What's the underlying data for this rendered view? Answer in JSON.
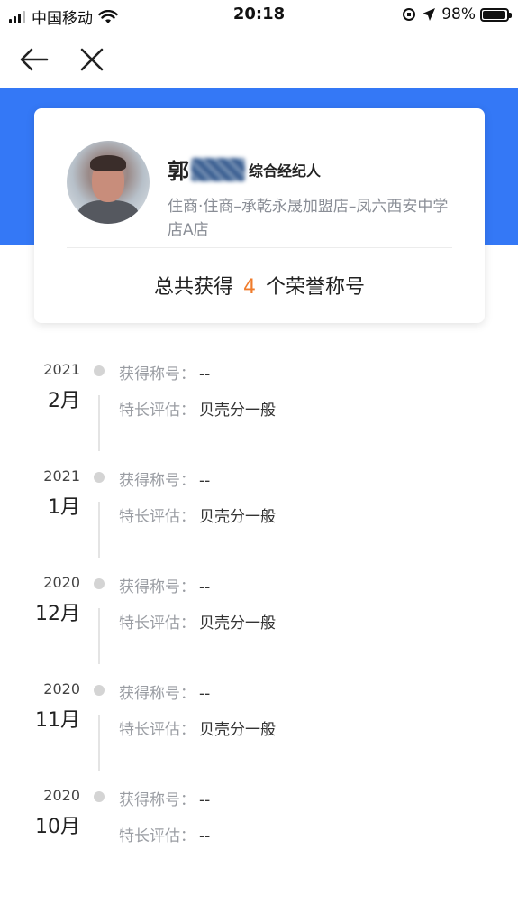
{
  "status_bar": {
    "carrier": "中国移动",
    "time": "20:18",
    "battery_percent": "98%",
    "battery_level": 0.98
  },
  "nav": {
    "back_icon": "arrow-left-icon",
    "close_icon": "close-icon"
  },
  "card": {
    "name": "郭",
    "role": "综合经纪人",
    "store": "住商·住商–承乾永晟加盟店–凤六西安中学店A店",
    "honor_prefix": "总共获得",
    "honor_count": "4",
    "honor_suffix": "个荣誉称号"
  },
  "timeline": {
    "title_label": "获得称号：",
    "eval_label": "特长评估：",
    "entries": [
      {
        "year": "2021",
        "month": "2月",
        "title": "--",
        "eval": "贝壳分一般"
      },
      {
        "year": "2021",
        "month": "1月",
        "title": "--",
        "eval": "贝壳分一般"
      },
      {
        "year": "2020",
        "month": "12月",
        "title": "--",
        "eval": "贝壳分一般"
      },
      {
        "year": "2020",
        "month": "11月",
        "title": "--",
        "eval": "贝壳分一般"
      },
      {
        "year": "2020",
        "month": "10月",
        "title": "--",
        "eval": "--"
      }
    ]
  },
  "colors": {
    "accent_blue": "#3478f6",
    "honor_orange": "#f07c2c"
  }
}
